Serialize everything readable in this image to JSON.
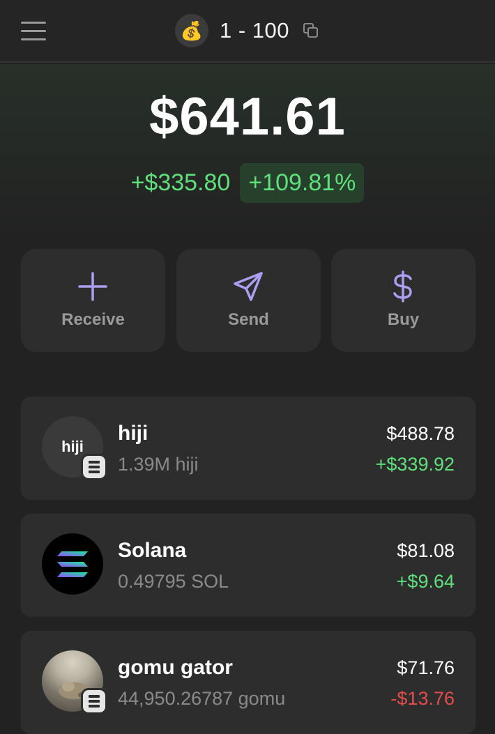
{
  "header": {
    "account_emoji": "💰",
    "account_name": "1 - 100"
  },
  "portfolio": {
    "balance": "$641.61",
    "change_amount": "+$335.80",
    "change_percent": "+109.81%"
  },
  "actions": [
    {
      "label": "Receive",
      "icon": "plus-icon"
    },
    {
      "label": "Send",
      "icon": "send-icon"
    },
    {
      "label": "Buy",
      "icon": "dollar-icon"
    }
  ],
  "tokens": [
    {
      "name": "hiji",
      "logo_text": "hiji",
      "amount": "1.39M hiji",
      "value": "$488.78",
      "change": "+$339.92",
      "direction": "up"
    },
    {
      "name": "Solana",
      "amount": "0.49795 SOL",
      "value": "$81.08",
      "change": "+$9.64",
      "direction": "up"
    },
    {
      "name": "gomu gator",
      "amount": "44,950.26787 gomu",
      "value": "$71.76",
      "change": "-$13.76",
      "direction": "down"
    }
  ],
  "colors": {
    "accent": "#ab9ff2",
    "positive": "#5fe07c",
    "negative": "#e54b4b",
    "background": "#222222",
    "card": "#2d2d2d"
  }
}
